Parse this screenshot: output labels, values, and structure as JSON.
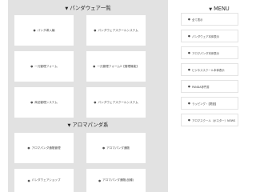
{
  "sections": [
    {
      "title": "パンダウェア一覧",
      "cards": [
        "パンダ導入編",
        "パンダウェアスクールシステム",
        "一元管理フォーム",
        "一元管理フォーム2【管理機能】",
        "商品管理システム",
        "パンダウェアスクールシステム"
      ]
    },
    {
      "title": "アロマパンダ系",
      "cards": [
        "アロマパンダ通販管理",
        "アロマパンダ通販",
        "パンダウェアショップ",
        "アロマパンダ通販(品種)"
      ]
    }
  ],
  "sidebar": {
    "title": "MENU",
    "items": [
      "全て表示",
      "パンダウェア本体表示",
      "アロマパンダ本体表示",
      "ビジネススクール本体表示",
      "PANDA専門書",
      "ラッピング・【関連】",
      "アロマスクール（ポスター）NEWS"
    ]
  },
  "icons": {
    "section_toggle": "triangle-down-icon",
    "item_bullet": "bullet-icon"
  },
  "colors": {
    "main_background": "#e2e2e2",
    "card_background": "#ffffff"
  }
}
